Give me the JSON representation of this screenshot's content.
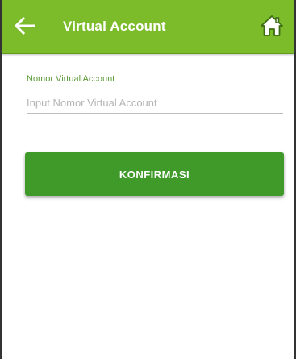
{
  "appbar": {
    "title": "Virtual Account",
    "back_icon": "arrow-left-icon",
    "home_icon": "home-icon",
    "color": "#7cbb2a"
  },
  "form": {
    "label": "Nomor Virtual Account",
    "placeholder": "Input Nomor Virtual Account",
    "value": ""
  },
  "confirm_button": {
    "label": "KONFIRMASI",
    "color": "#3f9a2a"
  }
}
